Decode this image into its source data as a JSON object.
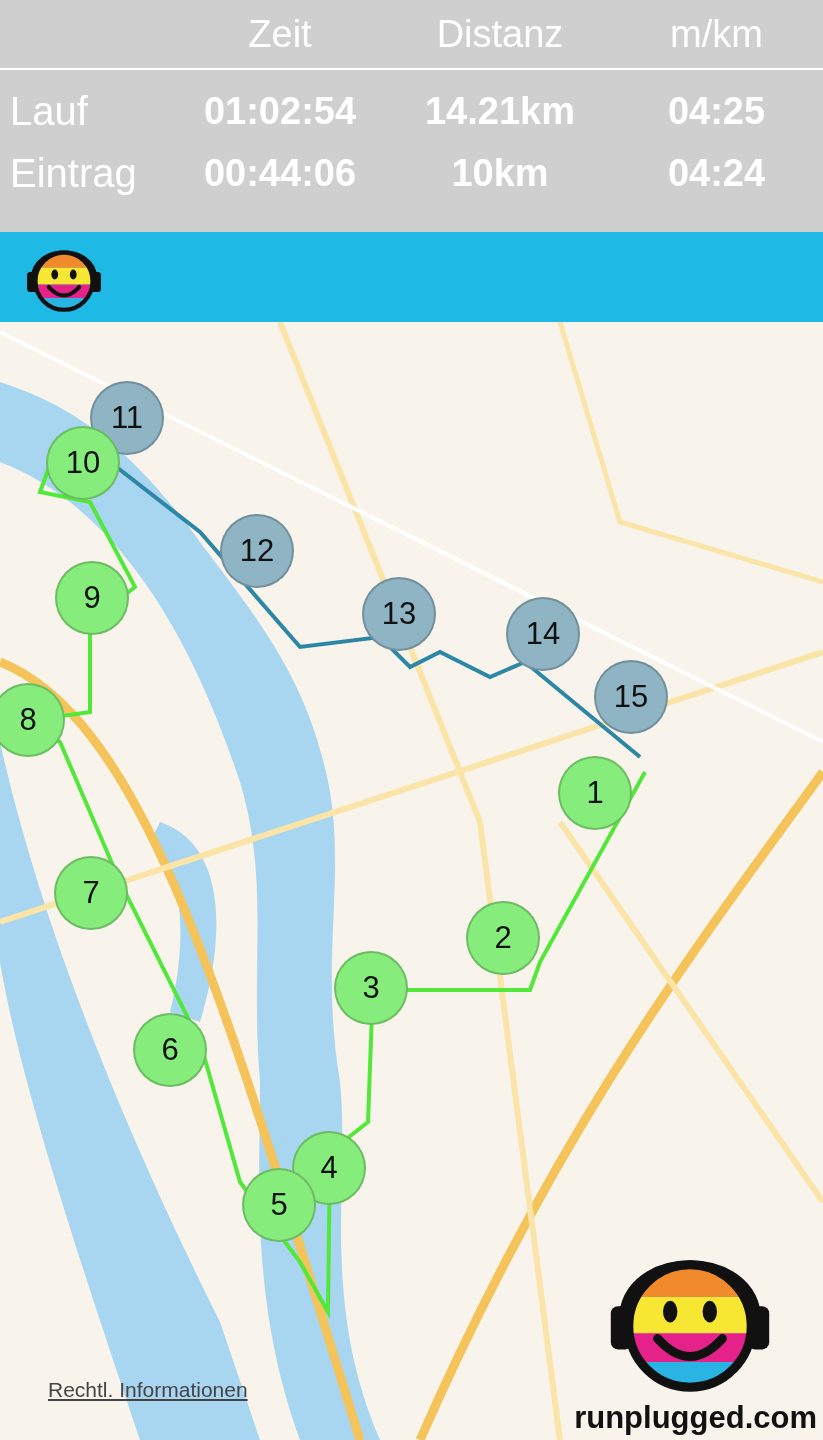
{
  "header": {
    "columns": [
      "Zeit",
      "Distanz",
      "m/km"
    ],
    "rows": [
      {
        "label": "Lauf",
        "values": [
          "01:02:54",
          "14.21km",
          "04:25"
        ]
      },
      {
        "label": "Eintrag",
        "values": [
          "00:44:06",
          "10km",
          "04:24"
        ]
      }
    ]
  },
  "markers": [
    {
      "label": "11",
      "color": "#8fb4c4"
    },
    {
      "label": "10",
      "color": "#86ec7c"
    },
    {
      "label": "12",
      "color": "#8fb4c4"
    },
    {
      "label": "9",
      "color": "#86ec7c"
    },
    {
      "label": "13",
      "color": "#8fb4c4"
    },
    {
      "label": "14",
      "color": "#8fb4c4"
    },
    {
      "label": "15",
      "color": "#8fb4c4"
    },
    {
      "label": "8",
      "color": "#86ec7c"
    },
    {
      "label": "1",
      "color": "#86ec7c"
    },
    {
      "label": "7",
      "color": "#86ec7c"
    },
    {
      "label": "2",
      "color": "#86ec7c"
    },
    {
      "label": "3",
      "color": "#86ec7c"
    },
    {
      "label": "6",
      "color": "#86ec7c"
    },
    {
      "label": "4",
      "color": "#86ec7c"
    },
    {
      "label": "5",
      "color": "#86ec7c"
    }
  ],
  "legal_link": "Rechtl. Informationen",
  "brand": "runplugged.com"
}
